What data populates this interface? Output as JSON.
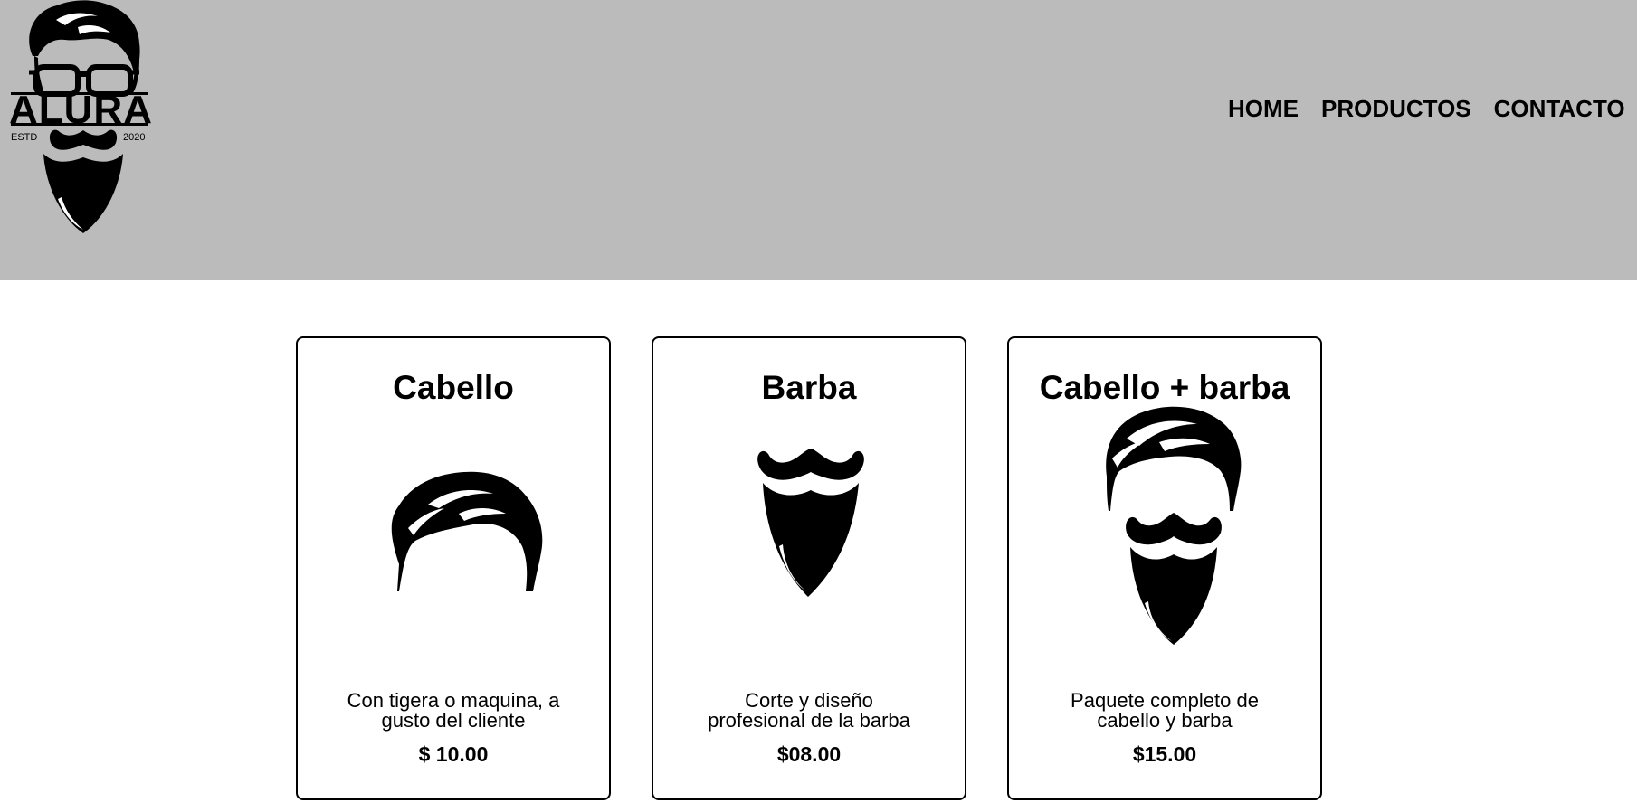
{
  "logo": {
    "wordmark": "ALURA",
    "left_text": "ESTD",
    "right_text": "2020",
    "icon": "barber-logo-icon"
  },
  "nav": {
    "items": [
      "HOME",
      "PRODUCTOS",
      "CONTACTO"
    ]
  },
  "colors": {
    "header_bg": "#bbbbbb",
    "card_border": "#000000",
    "text": "#000000"
  },
  "products": [
    {
      "title": "Cabello",
      "icon": "hair-icon",
      "description": "Con tigera o maquina, a gusto del cliente",
      "price": "$ 10.00"
    },
    {
      "title": "Barba",
      "icon": "beard-icon",
      "description": "Corte y diseño profesional de la barba",
      "price": "$08.00"
    },
    {
      "title": "Cabello + barba",
      "icon": "hair-and-beard-icon",
      "description": "Paquete completo de cabello y barba",
      "price": "$15.00"
    }
  ]
}
